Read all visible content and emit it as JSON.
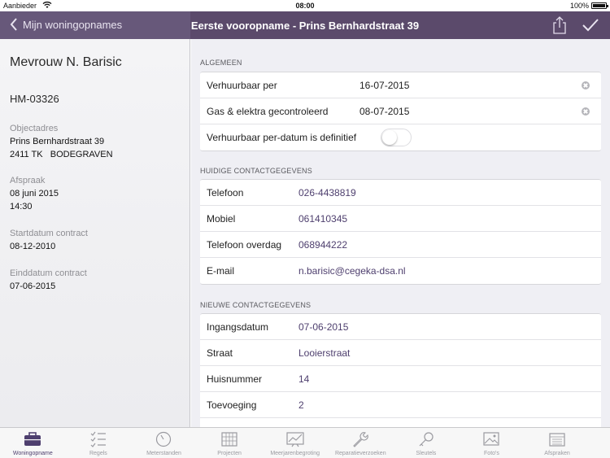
{
  "status_bar": {
    "carrier": "Aanbieder",
    "time": "08:00",
    "battery": "100%"
  },
  "nav": {
    "back_label": "Mijn woningopnames",
    "title": "Eerste vooropname - Prins Bernhardstraat 39",
    "share_icon": "share-icon",
    "done_icon": "checkmark-icon"
  },
  "client": {
    "name": "Mevrouw N. Barisic",
    "code": "HM-03326",
    "address_label": "Objectadres",
    "address_line1": "Prins Bernhardstraat 39",
    "address_line2": "2411 TK   BODEGRAVEN",
    "appointment_label": "Afspraak",
    "appointment_date": "08 juni 2015",
    "appointment_time": "14:30",
    "contract_start_label": "Startdatum contract",
    "contract_start": "08-12-2010",
    "contract_end_label": "Einddatum contract",
    "contract_end": "07-06-2015"
  },
  "sections": {
    "general": {
      "header": "ALGEMEEN",
      "rows": [
        {
          "label": "Verhuurbaar per",
          "value": "16-07-2015"
        },
        {
          "label": "Gas & elektra gecontroleerd",
          "value": "08-07-2015"
        },
        {
          "label": "Verhuurbaar per-datum is definitief",
          "toggle_on": false
        }
      ]
    },
    "current_contact": {
      "header": "HUIDIGE CONTACTGEGEVENS",
      "rows": [
        {
          "label": "Telefoon",
          "value": "026-4438819"
        },
        {
          "label": "Mobiel",
          "value": "061410345"
        },
        {
          "label": "Telefoon overdag",
          "value": "068944222"
        },
        {
          "label": "E-mail",
          "value": "n.barisic@cegeka-dsa.nl"
        }
      ]
    },
    "new_contact": {
      "header": "NIEUWE CONTACTGEGEVENS",
      "rows": [
        {
          "label": "Ingangsdatum",
          "value": "07-06-2015"
        },
        {
          "label": "Straat",
          "value": "Looierstraat"
        },
        {
          "label": "Huisnummer",
          "value": "14"
        },
        {
          "label": "Toevoeging",
          "value": "2"
        }
      ]
    }
  },
  "tabs": [
    {
      "label": "Woningopname",
      "icon": "briefcase-icon",
      "active": true
    },
    {
      "label": "Regels",
      "icon": "checklist-icon",
      "active": false
    },
    {
      "label": "Meterstanden",
      "icon": "gauge-icon",
      "active": false
    },
    {
      "label": "Projecten",
      "icon": "grid-icon",
      "active": false
    },
    {
      "label": "Meerjarenbegroting",
      "icon": "chart-icon",
      "active": false
    },
    {
      "label": "Reparatieverzoeken",
      "icon": "wrench-icon",
      "active": false
    },
    {
      "label": "Sleutels",
      "icon": "key-icon",
      "active": false
    },
    {
      "label": "Foto's",
      "icon": "photo-icon",
      "active": false
    },
    {
      "label": "Afspraken",
      "icon": "calendar-icon",
      "active": false
    }
  ],
  "colors": {
    "nav_bg": "#5b4a6b",
    "accent": "#4e3f6e",
    "pane_bg": "#efeff4"
  }
}
